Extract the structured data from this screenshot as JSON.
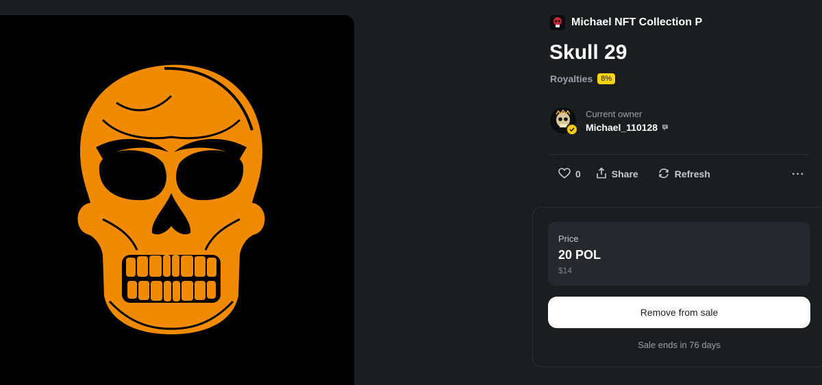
{
  "collection": {
    "name": "Michael NFT Collection P",
    "thumb_icon": "skull-icon"
  },
  "nft": {
    "title": "Skull 29"
  },
  "royalties": {
    "label": "Royalties",
    "value": "8%"
  },
  "owner": {
    "label": "Current owner",
    "name": "Michael_110128",
    "verified": true
  },
  "actions": {
    "likes": "0",
    "share": "Share",
    "refresh": "Refresh",
    "more": "···"
  },
  "price": {
    "label": "Price",
    "amount": "20 POL",
    "usd": "$14"
  },
  "buttons": {
    "remove_from_sale": "Remove from sale"
  },
  "sale": {
    "ends": "Sale ends in 76 days"
  },
  "colors": {
    "background": "#1b1e21",
    "accent": "#f6d60b",
    "skull": "#f08a00"
  }
}
